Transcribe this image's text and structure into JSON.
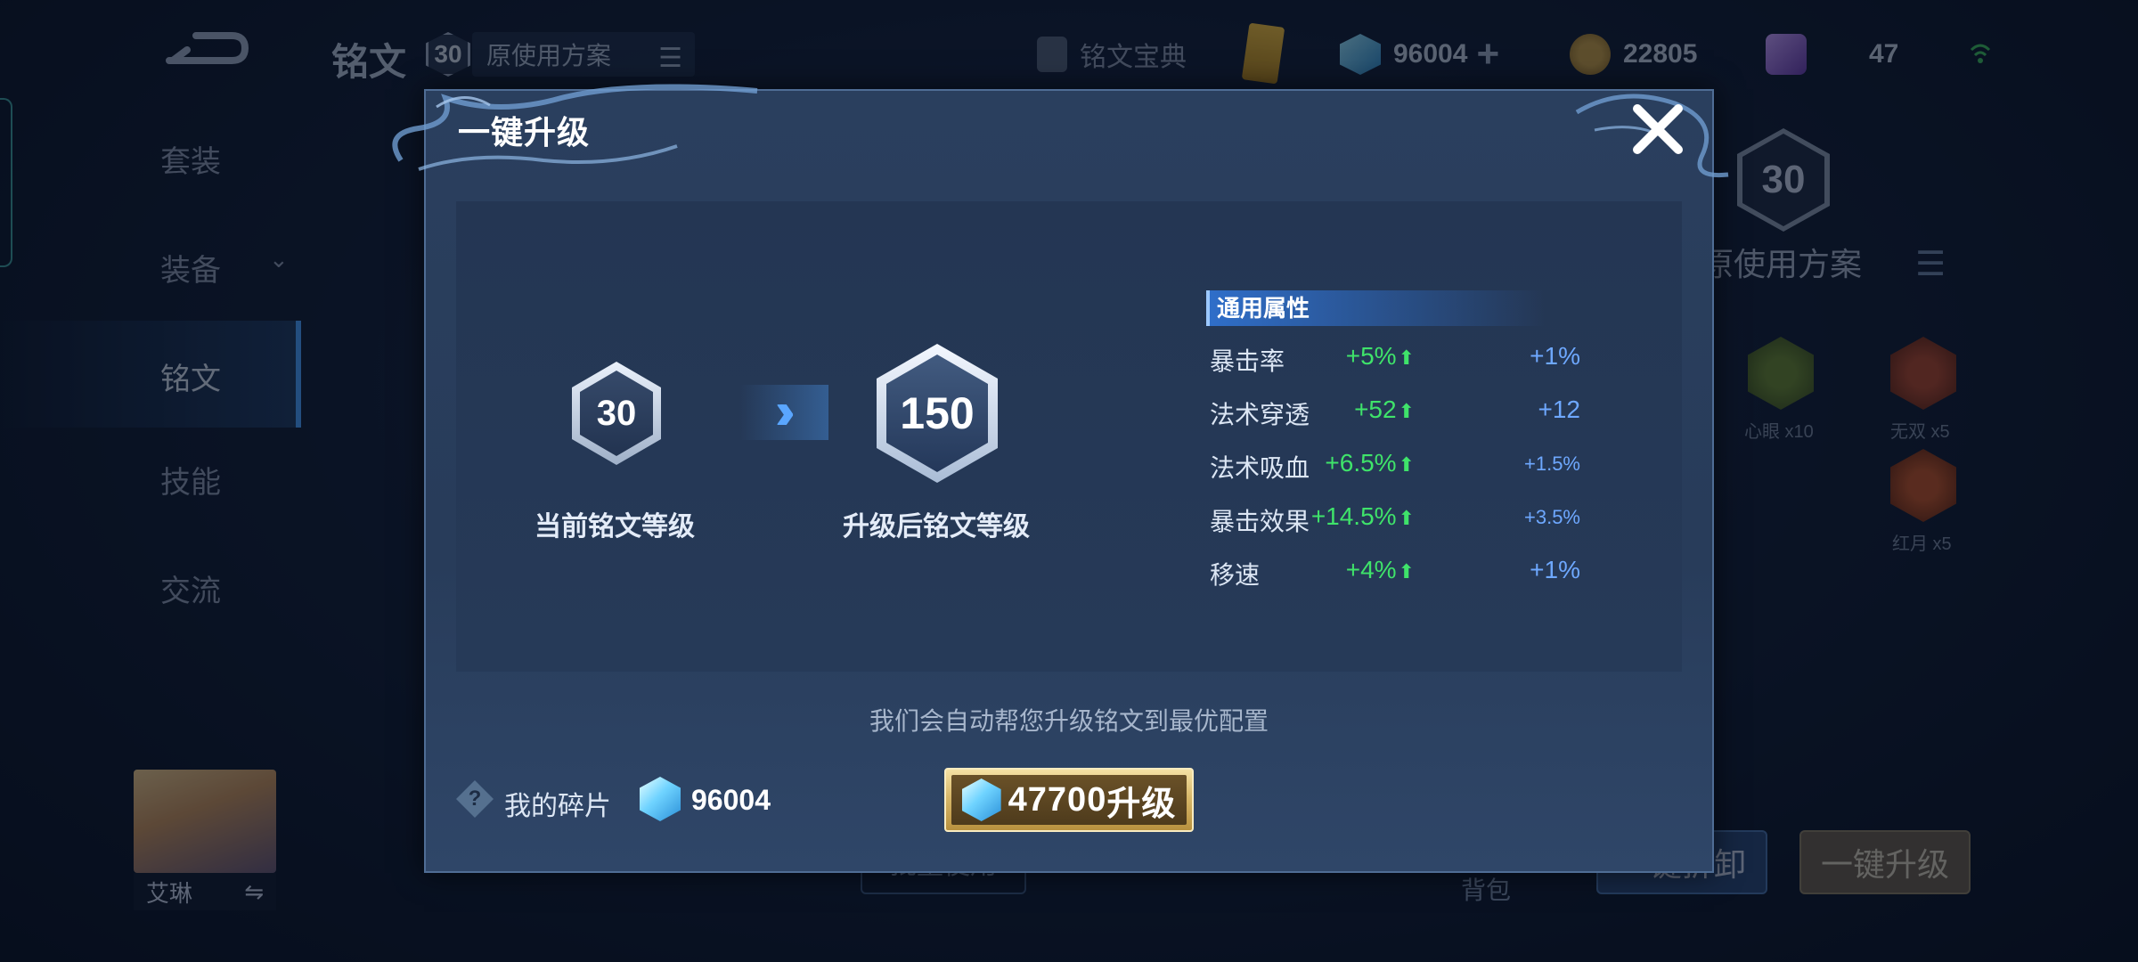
{
  "header": {
    "title": "铭文",
    "level": "30",
    "scheme": "原使用方案",
    "codex_label": "铭文宝典",
    "shard_count": "96004",
    "gold": "22805",
    "gems": "47"
  },
  "sidebar": {
    "items": [
      {
        "label": "套装"
      },
      {
        "label": "装备"
      },
      {
        "label": "铭文"
      },
      {
        "label": "技能"
      },
      {
        "label": "交流"
      }
    ],
    "active_index": 2
  },
  "hero": {
    "name": "艾琳",
    "swap_icon": "⇋"
  },
  "right_panel": {
    "level": "30",
    "scheme": "原使用方案",
    "runes": [
      {
        "label": "心眼 x10"
      },
      {
        "label": "无双 x5"
      },
      {
        "label": "红月 x5"
      }
    ]
  },
  "bottom_bar": {
    "left_btn": "批量使用",
    "bag": "背包",
    "unload_btn": "一键拆卸",
    "upgrade_btn": "一键升级"
  },
  "modal": {
    "title": "一键升级",
    "current_level": "30",
    "current_label": "当前铭文等级",
    "new_level": "150",
    "new_label": "升级后铭文等级",
    "attr_header": "通用属性",
    "attributes": [
      {
        "name": "暴击率",
        "up": "+5%",
        "cur": "+1%"
      },
      {
        "name": "法术穿透",
        "up": "+52",
        "cur": "+12"
      },
      {
        "name": "法术吸血",
        "up": "+6.5%",
        "cur": "+1.5%"
      },
      {
        "name": "暴击效果",
        "up": "+14.5%",
        "cur": "+3.5%"
      },
      {
        "name": "移速",
        "up": "+4%",
        "cur": "+1%"
      }
    ],
    "note": "我们会自动帮您升级铭文到最优配置",
    "my_shards_label": "我的碎片",
    "my_shards": "96004",
    "upgrade_cost": "47700",
    "upgrade_label": "升级",
    "up_icon": "⬆"
  },
  "colors": {
    "positive": "#3fe36a",
    "current": "#6ea8ff",
    "accent": "#4aa3ff",
    "gold_button": "#d8b86a"
  }
}
